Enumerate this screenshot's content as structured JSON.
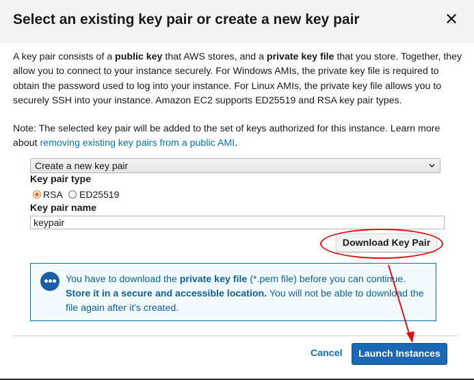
{
  "dialog": {
    "title": "Select an existing key pair or create a new key pair",
    "close_icon": "close-icon",
    "close_glyph": "✕"
  },
  "intro": {
    "t1": "A key pair consists of a ",
    "b1": "public key",
    "t2": " that AWS stores, and a ",
    "b2": "private key file",
    "t3": " that you store. Together, they allow you to connect to your instance securely. For Windows AMIs, the private key file is required to obtain the password used to log into your instance. For Linux AMIs, the private key file allows you to securely SSH into your instance. Amazon EC2 supports ED25519 and RSA key pair types."
  },
  "note": {
    "text": "Note: The selected key pair will be added to the set of keys authorized for this instance. Learn more about ",
    "link": "removing existing key pairs from a public AMI",
    "end": "."
  },
  "keypair_select": {
    "selected": "Create a new key pair",
    "chevron": "⌄"
  },
  "key_type": {
    "label": "Key pair type",
    "options": [
      {
        "label": "RSA",
        "selected": true
      },
      {
        "label": "ED25519",
        "selected": false
      }
    ]
  },
  "key_name": {
    "label": "Key pair name",
    "value": "keypair"
  },
  "download_button": "Download Key Pair",
  "info": {
    "t1": "You have to download the ",
    "b1": "private key file",
    "t2": " (*.pem file) before you can continue. ",
    "b2": "Store it in a secure and accessible location.",
    "t3": " You will not be able to download the file again after it's created."
  },
  "footer": {
    "cancel": "Cancel",
    "launch": "Launch Instances"
  },
  "colors": {
    "accent_blue": "#0073bb",
    "primary_button": "#1a68b5",
    "annotation_red": "#dd1010",
    "radio_orange": "#ec7211",
    "info_background": "#f1faff"
  }
}
